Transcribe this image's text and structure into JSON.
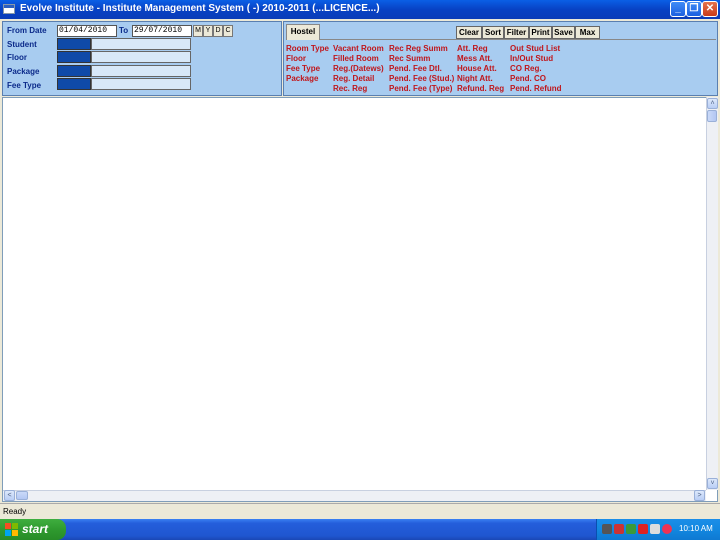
{
  "window": {
    "title": "Evolve Institute - Institute Management System ( -) 2010-2011 (...LICENCE...)",
    "min_glyph": "_",
    "max_glyph": "❐",
    "close_glyph": "✕"
  },
  "filters": {
    "from_date_label": "From Date",
    "from_date": "01/04/2010",
    "to_label": "To",
    "to_date": "29/07/2010",
    "period_buttons": [
      "M",
      "Y",
      "D",
      "C"
    ],
    "fields": [
      "Student",
      "Floor",
      "Package",
      "Fee Type"
    ]
  },
  "toolbar": {
    "tab_label": "Hostel",
    "buttons": [
      "Clear",
      "Sort",
      "Filter",
      "Print",
      "Save",
      "Max"
    ]
  },
  "report_links": {
    "col1": [
      "Room Type",
      "Floor",
      "Fee Type",
      "Package"
    ],
    "col2": [
      "Vacant Room",
      "Filled Room",
      "Reg.(Datews)",
      "Reg. Detail",
      "Rec. Reg"
    ],
    "col3": [
      "Rec Reg Summ",
      "Rec Summ",
      "Pend. Fee Dtl.",
      "Pend. Fee (Stud.)",
      "Pend. Fee (Type)"
    ],
    "col4": [
      "Att. Reg",
      "Mess Att.",
      "House Att.",
      "Night Att.",
      "Refund. Reg"
    ],
    "col5": [
      "Out Stud List",
      "In/Out Stud",
      "CO Reg.",
      "Pend. CO",
      "Pend. Refund"
    ]
  },
  "scroll": {
    "up": "˄",
    "down": "˅",
    "left": "<",
    "right": ">"
  },
  "status": {
    "text": "Ready"
  },
  "taskbar": {
    "start_label": "start",
    "clock": "10:10 AM"
  },
  "colors": {
    "panel": "#a8ccf0",
    "label_blue": "#0b2a8a",
    "link_red": "#c0161b",
    "code_box": "#0f4aa8"
  }
}
